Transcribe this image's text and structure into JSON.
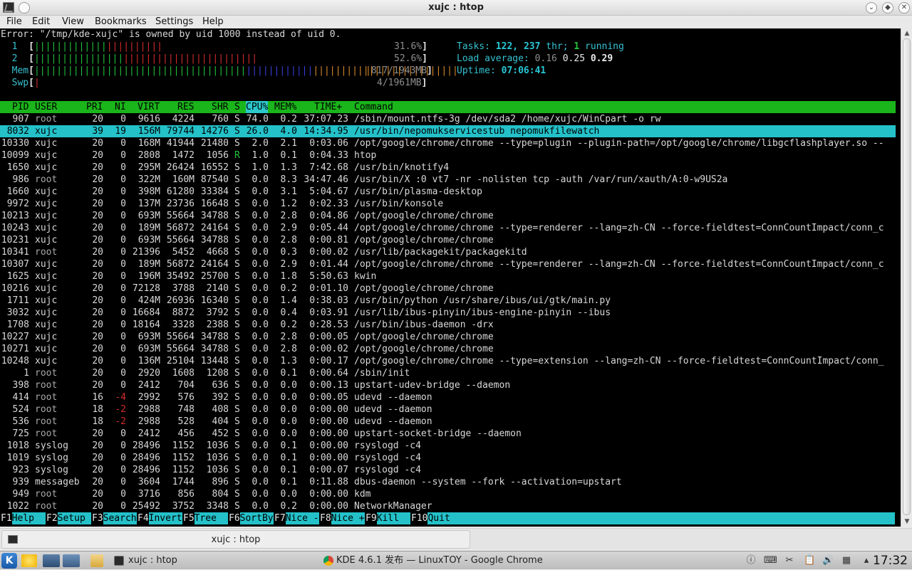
{
  "window": {
    "title": "xujc : htop"
  },
  "menubar": [
    "File",
    "Edit",
    "View",
    "Bookmarks",
    "Settings",
    "Help"
  ],
  "terminal": {
    "error_line": "Error: \"/tmp/kde-xujc\" is owned by uid 1000 instead of uid 0.",
    "meters": {
      "cpu1": {
        "label": "1",
        "value": "31.6%",
        "green_fraction": 0.55,
        "red_fraction": 0.45
      },
      "cpu2": {
        "label": "2",
        "value": "52.6%",
        "green_fraction": 0.4,
        "red_fraction": 0.6
      },
      "mem": {
        "label": "Mem",
        "value": "817/1943MB"
      },
      "swp": {
        "label": "Swp",
        "value": "4/1961MB"
      }
    },
    "tasks": {
      "label": "Tasks:",
      "count": "122,",
      "threads": "237",
      "thr": "thr;",
      "running": "1",
      "running_label": "running"
    },
    "load": {
      "label": "Load average:",
      "l1": "0.16",
      "l5": "0.25",
      "l15": "0.29"
    },
    "uptime": {
      "label": "Uptime:",
      "value": "07:06:41"
    },
    "columns": [
      "PID",
      "USER",
      "PRI",
      "NI",
      "VIRT",
      "RES",
      "SHR",
      "S",
      "CPU%",
      "MEM%",
      "TIME+",
      "Command"
    ],
    "processes": [
      {
        "pid": "907",
        "user": "root",
        "pri": "20",
        "ni": "0",
        "virt": "9616",
        "res": "4224",
        "shr": "760",
        "s": "S",
        "cpu": "74.0",
        "mem": "0.2",
        "time": "37:07.23",
        "cmd": "/sbin/mount.ntfs-3g /dev/sda2 /home/xujc/WinCpart -o rw"
      },
      {
        "pid": "8032",
        "user": "xujc",
        "pri": "39",
        "ni": "19",
        "virt": "156M",
        "res": "79744",
        "shr": "14276",
        "s": "S",
        "cpu": "26.0",
        "mem": "4.0",
        "time": "14:34.95",
        "cmd": "/usr/bin/nepomukservicestub nepomukfilewatch"
      },
      {
        "pid": "10330",
        "user": "xujc",
        "pri": "20",
        "ni": "0",
        "virt": "168M",
        "res": "41944",
        "shr": "21480",
        "s": "S",
        "cpu": "2.0",
        "mem": "2.1",
        "time": "0:03.06",
        "cmd": "/opt/google/chrome/chrome --type=plugin --plugin-path=/opt/google/chrome/libgcflashplayer.so --"
      },
      {
        "pid": "10099",
        "user": "xujc",
        "pri": "20",
        "ni": "0",
        "virt": "2808",
        "res": "1472",
        "shr": "1056",
        "s": "R",
        "cpu": "1.0",
        "mem": "0.1",
        "time": "0:04.33",
        "cmd": "htop"
      },
      {
        "pid": "1650",
        "user": "xujc",
        "pri": "20",
        "ni": "0",
        "virt": "295M",
        "res": "26424",
        "shr": "16552",
        "s": "S",
        "cpu": "1.0",
        "mem": "1.3",
        "time": "7:42.68",
        "cmd": "/usr/bin/knotify4"
      },
      {
        "pid": "986",
        "user": "root",
        "pri": "20",
        "ni": "0",
        "virt": "322M",
        "res": "160M",
        "shr": "87540",
        "s": "S",
        "cpu": "0.0",
        "mem": "8.3",
        "time": "34:47.46",
        "cmd": "/usr/bin/X :0 vt7 -nr -nolisten tcp -auth /var/run/xauth/A:0-w9US2a"
      },
      {
        "pid": "1660",
        "user": "xujc",
        "pri": "20",
        "ni": "0",
        "virt": "398M",
        "res": "61280",
        "shr": "33384",
        "s": "S",
        "cpu": "0.0",
        "mem": "3.1",
        "time": "5:04.67",
        "cmd": "/usr/bin/plasma-desktop"
      },
      {
        "pid": "9972",
        "user": "xujc",
        "pri": "20",
        "ni": "0",
        "virt": "137M",
        "res": "23736",
        "shr": "16648",
        "s": "S",
        "cpu": "0.0",
        "mem": "1.2",
        "time": "0:02.33",
        "cmd": "/usr/bin/konsole"
      },
      {
        "pid": "10213",
        "user": "xujc",
        "pri": "20",
        "ni": "0",
        "virt": "693M",
        "res": "55664",
        "shr": "34788",
        "s": "S",
        "cpu": "0.0",
        "mem": "2.8",
        "time": "0:04.86",
        "cmd": "/opt/google/chrome/chrome"
      },
      {
        "pid": "10243",
        "user": "xujc",
        "pri": "20",
        "ni": "0",
        "virt": "189M",
        "res": "56872",
        "shr": "24164",
        "s": "S",
        "cpu": "0.0",
        "mem": "2.9",
        "time": "0:05.44",
        "cmd": "/opt/google/chrome/chrome --type=renderer --lang=zh-CN --force-fieldtest=ConnCountImpact/conn_c"
      },
      {
        "pid": "10231",
        "user": "xujc",
        "pri": "20",
        "ni": "0",
        "virt": "693M",
        "res": "55664",
        "shr": "34788",
        "s": "S",
        "cpu": "0.0",
        "mem": "2.8",
        "time": "0:00.81",
        "cmd": "/opt/google/chrome/chrome"
      },
      {
        "pid": "10341",
        "user": "root",
        "pri": "20",
        "ni": "0",
        "virt": "21396",
        "res": "5452",
        "shr": "4668",
        "s": "S",
        "cpu": "0.0",
        "mem": "0.3",
        "time": "0:00.02",
        "cmd": "/usr/lib/packagekit/packagekitd"
      },
      {
        "pid": "10307",
        "user": "xujc",
        "pri": "20",
        "ni": "0",
        "virt": "189M",
        "res": "56872",
        "shr": "24164",
        "s": "S",
        "cpu": "0.0",
        "mem": "2.9",
        "time": "0:01.44",
        "cmd": "/opt/google/chrome/chrome --type=renderer --lang=zh-CN --force-fieldtest=ConnCountImpact/conn_c"
      },
      {
        "pid": "1625",
        "user": "xujc",
        "pri": "20",
        "ni": "0",
        "virt": "196M",
        "res": "35492",
        "shr": "25700",
        "s": "S",
        "cpu": "0.0",
        "mem": "1.8",
        "time": "5:50.63",
        "cmd": "kwin"
      },
      {
        "pid": "10216",
        "user": "xujc",
        "pri": "20",
        "ni": "0",
        "virt": "72128",
        "res": "3788",
        "shr": "2140",
        "s": "S",
        "cpu": "0.0",
        "mem": "0.2",
        "time": "0:01.10",
        "cmd": "/opt/google/chrome/chrome"
      },
      {
        "pid": "1711",
        "user": "xujc",
        "pri": "20",
        "ni": "0",
        "virt": "424M",
        "res": "26936",
        "shr": "16340",
        "s": "S",
        "cpu": "0.0",
        "mem": "1.4",
        "time": "0:38.03",
        "cmd": "/usr/bin/python /usr/share/ibus/ui/gtk/main.py"
      },
      {
        "pid": "3032",
        "user": "xujc",
        "pri": "20",
        "ni": "0",
        "virt": "16684",
        "res": "8872",
        "shr": "3792",
        "s": "S",
        "cpu": "0.0",
        "mem": "0.4",
        "time": "0:03.91",
        "cmd": "/usr/lib/ibus-pinyin/ibus-engine-pinyin --ibus"
      },
      {
        "pid": "1708",
        "user": "xujc",
        "pri": "20",
        "ni": "0",
        "virt": "18164",
        "res": "3328",
        "shr": "2388",
        "s": "S",
        "cpu": "0.0",
        "mem": "0.2",
        "time": "0:28.53",
        "cmd": "/usr/bin/ibus-daemon -drx"
      },
      {
        "pid": "10227",
        "user": "xujc",
        "pri": "20",
        "ni": "0",
        "virt": "693M",
        "res": "55664",
        "shr": "34788",
        "s": "S",
        "cpu": "0.0",
        "mem": "2.8",
        "time": "0:00.05",
        "cmd": "/opt/google/chrome/chrome"
      },
      {
        "pid": "10271",
        "user": "xujc",
        "pri": "20",
        "ni": "0",
        "virt": "693M",
        "res": "55664",
        "shr": "34788",
        "s": "S",
        "cpu": "0.0",
        "mem": "2.8",
        "time": "0:00.02",
        "cmd": "/opt/google/chrome/chrome"
      },
      {
        "pid": "10248",
        "user": "xujc",
        "pri": "20",
        "ni": "0",
        "virt": "136M",
        "res": "25104",
        "shr": "13448",
        "s": "S",
        "cpu": "0.0",
        "mem": "1.3",
        "time": "0:00.17",
        "cmd": "/opt/google/chrome/chrome --type=extension --lang=zh-CN --force-fieldtest=ConnCountImpact/conn_"
      },
      {
        "pid": "1",
        "user": "root",
        "pri": "20",
        "ni": "0",
        "virt": "2920",
        "res": "1608",
        "shr": "1208",
        "s": "S",
        "cpu": "0.0",
        "mem": "0.1",
        "time": "0:00.64",
        "cmd": "/sbin/init"
      },
      {
        "pid": "398",
        "user": "root",
        "pri": "20",
        "ni": "0",
        "virt": "2412",
        "res": "704",
        "shr": "636",
        "s": "S",
        "cpu": "0.0",
        "mem": "0.0",
        "time": "0:00.13",
        "cmd": "upstart-udev-bridge --daemon"
      },
      {
        "pid": "414",
        "user": "root",
        "pri": "16",
        "ni": "-4",
        "virt": "2992",
        "res": "576",
        "shr": "392",
        "s": "S",
        "cpu": "0.0",
        "mem": "0.0",
        "time": "0:00.05",
        "cmd": "udevd --daemon"
      },
      {
        "pid": "524",
        "user": "root",
        "pri": "18",
        "ni": "-2",
        "virt": "2988",
        "res": "748",
        "shr": "408",
        "s": "S",
        "cpu": "0.0",
        "mem": "0.0",
        "time": "0:00.00",
        "cmd": "udevd --daemon"
      },
      {
        "pid": "536",
        "user": "root",
        "pri": "18",
        "ni": "-2",
        "virt": "2988",
        "res": "528",
        "shr": "404",
        "s": "S",
        "cpu": "0.0",
        "mem": "0.0",
        "time": "0:00.00",
        "cmd": "udevd --daemon"
      },
      {
        "pid": "725",
        "user": "root",
        "pri": "20",
        "ni": "0",
        "virt": "2412",
        "res": "456",
        "shr": "452",
        "s": "S",
        "cpu": "0.0",
        "mem": "0.0",
        "time": "0:00.00",
        "cmd": "upstart-socket-bridge --daemon"
      },
      {
        "pid": "1018",
        "user": "syslog",
        "pri": "20",
        "ni": "0",
        "virt": "28496",
        "res": "1152",
        "shr": "1036",
        "s": "S",
        "cpu": "0.0",
        "mem": "0.1",
        "time": "0:00.00",
        "cmd": "rsyslogd -c4"
      },
      {
        "pid": "1019",
        "user": "syslog",
        "pri": "20",
        "ni": "0",
        "virt": "28496",
        "res": "1152",
        "shr": "1036",
        "s": "S",
        "cpu": "0.0",
        "mem": "0.1",
        "time": "0:00.00",
        "cmd": "rsyslogd -c4"
      },
      {
        "pid": "923",
        "user": "syslog",
        "pri": "20",
        "ni": "0",
        "virt": "28496",
        "res": "1152",
        "shr": "1036",
        "s": "S",
        "cpu": "0.0",
        "mem": "0.1",
        "time": "0:00.07",
        "cmd": "rsyslogd -c4"
      },
      {
        "pid": "939",
        "user": "messageb",
        "pri": "20",
        "ni": "0",
        "virt": "3604",
        "res": "1744",
        "shr": "896",
        "s": "S",
        "cpu": "0.0",
        "mem": "0.1",
        "time": "0:11.88",
        "cmd": "dbus-daemon --system --fork --activation=upstart"
      },
      {
        "pid": "949",
        "user": "root",
        "pri": "20",
        "ni": "0",
        "virt": "3716",
        "res": "856",
        "shr": "804",
        "s": "S",
        "cpu": "0.0",
        "mem": "0.0",
        "time": "0:00.00",
        "cmd": "kdm"
      },
      {
        "pid": "1022",
        "user": "root",
        "pri": "20",
        "ni": "0",
        "virt": "25492",
        "res": "3752",
        "shr": "3348",
        "s": "S",
        "cpu": "0.0",
        "mem": "0.2",
        "time": "0:00.00",
        "cmd": "NetworkManager"
      }
    ],
    "fkeys": [
      {
        "key": "F1",
        "label": "Help  "
      },
      {
        "key": "F2",
        "label": "Setup "
      },
      {
        "key": "F3",
        "label": "Search"
      },
      {
        "key": "F4",
        "label": "Invert"
      },
      {
        "key": "F5",
        "label": "Tree  "
      },
      {
        "key": "F6",
        "label": "SortBy"
      },
      {
        "key": "F7",
        "label": "Nice -"
      },
      {
        "key": "F8",
        "label": "Nice +"
      },
      {
        "key": "F9",
        "label": "Kill  "
      },
      {
        "key": "F10",
        "label": "Quit"
      }
    ]
  },
  "tabbar": {
    "tab_label": "xujc : htop"
  },
  "taskbar": {
    "tasks": [
      "xujc : htop",
      "KDE 4.6.1 发布 — LinuxTOY - Google Chrome"
    ],
    "clock": "17:32"
  },
  "colors": {
    "terminal_bg": "#000000",
    "header_green": "#1ab51a",
    "selection_cyan": "#24c1c9"
  }
}
